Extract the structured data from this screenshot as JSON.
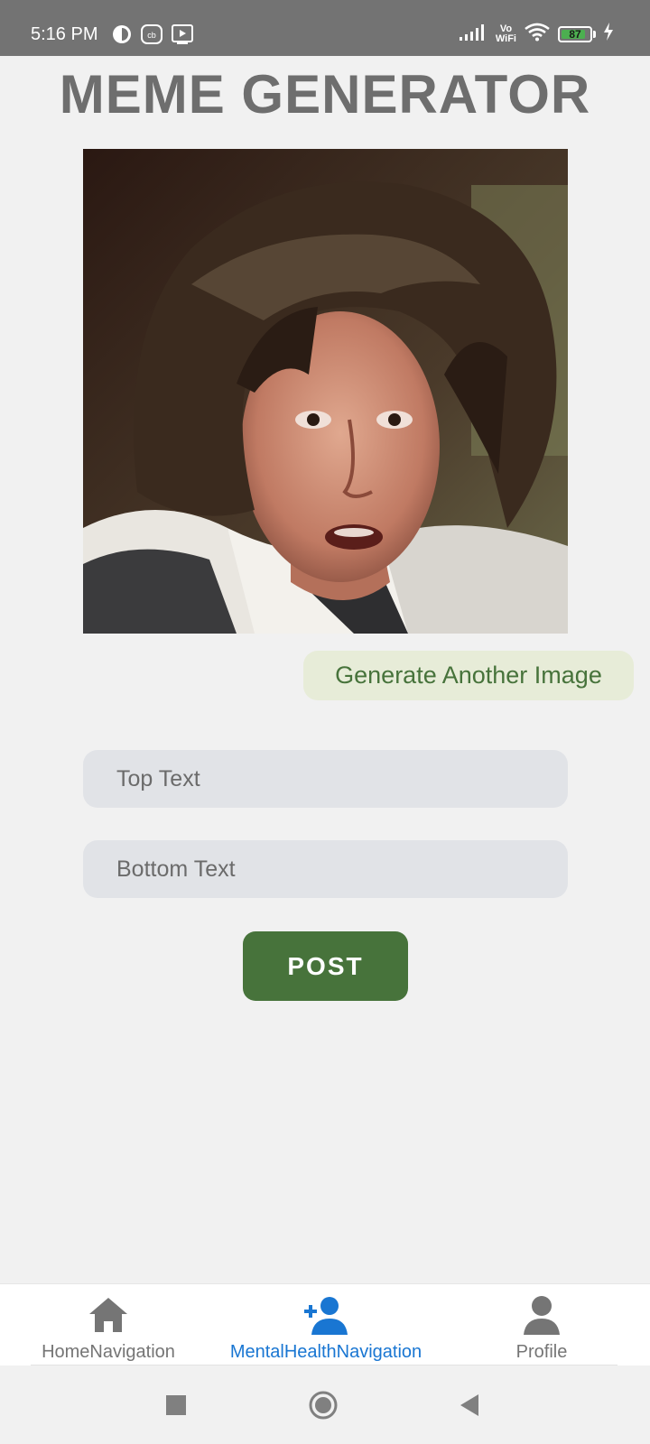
{
  "status_bar": {
    "time": "5:16 PM",
    "network_label_top": "Vo",
    "network_label_bottom": "WiFi",
    "battery_percent": "87",
    "battery_level": 0.87,
    "icons": [
      "app-icon",
      "cb-icon",
      "screen-icon",
      "signal-icon",
      "wifi-icon",
      "charging-icon"
    ]
  },
  "header": {
    "title": "MEME GENERATOR"
  },
  "meme": {
    "generate_label": "Generate Another Image"
  },
  "form": {
    "top_text_placeholder": "Top Text",
    "top_text_value": "",
    "bottom_text_placeholder": "Bottom Text",
    "bottom_text_value": "",
    "post_label": "POST"
  },
  "bottom_nav": {
    "items": [
      {
        "label": "HomeNavigation",
        "icon": "home-icon",
        "active": false
      },
      {
        "label": "MentalHealthNavigation",
        "icon": "add-person-icon",
        "active": true
      },
      {
        "label": "Profile",
        "icon": "person-icon",
        "active": false
      }
    ],
    "active_color": "#1976d2",
    "inactive_color": "#757575"
  },
  "system_nav": {
    "buttons": [
      "recents-button",
      "home-button",
      "back-button"
    ]
  },
  "colors": {
    "accent": "#47733b",
    "accent_soft": "#e7ecd8",
    "field_bg": "#e1e3e7",
    "background": "#f1f1f1"
  }
}
